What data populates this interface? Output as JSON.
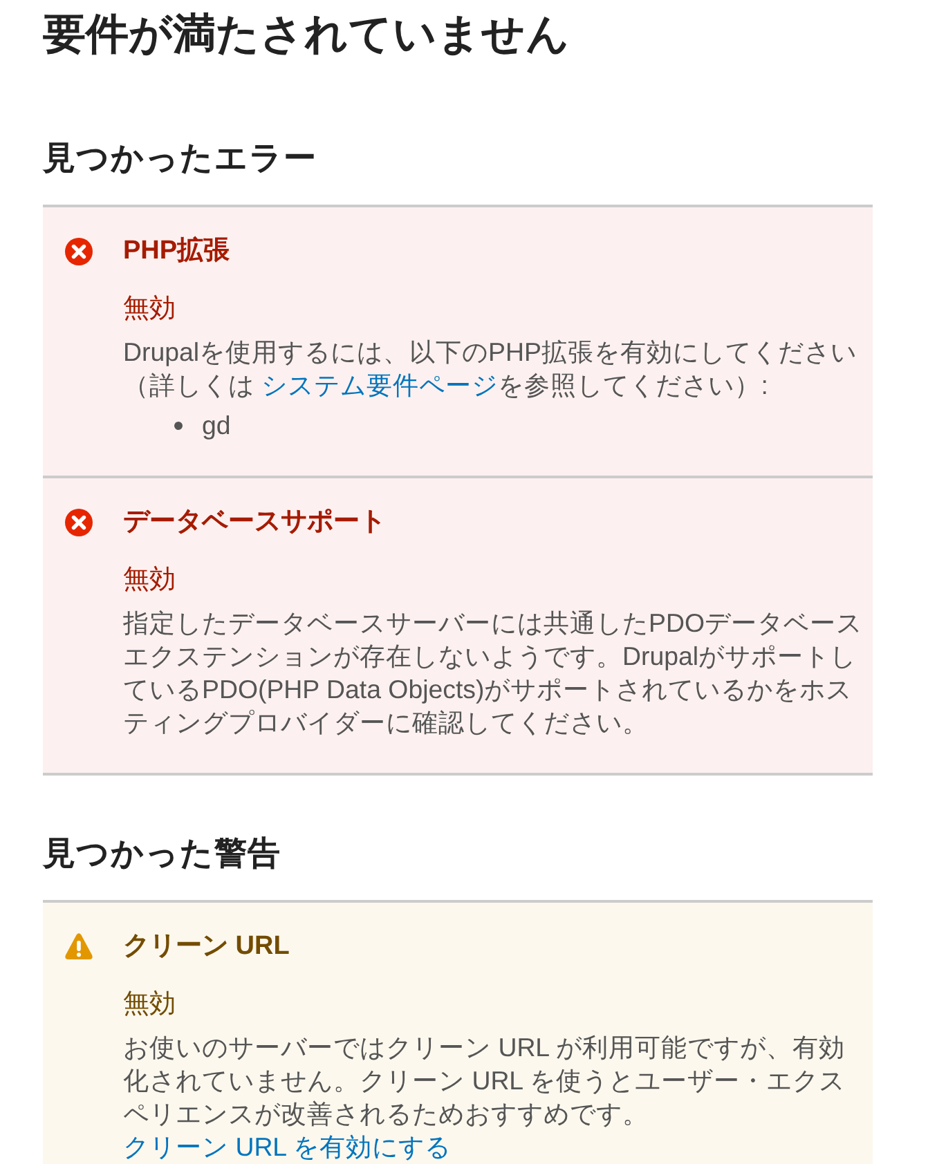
{
  "page_title": "要件が満たされていません",
  "sections": [
    {
      "heading": "見つかったエラー",
      "kind": "error",
      "items": [
        {
          "title": "PHP拡張",
          "status": "無効",
          "description": [
            {
              "kind": "text",
              "text": "Drupalを使用するには、以下のPHP拡張を有効にしてください（詳しくは "
            },
            {
              "kind": "link",
              "text": "システム要件ページ"
            },
            {
              "kind": "text",
              "text": "を参照してください）:"
            }
          ],
          "list": [
            "gd"
          ]
        },
        {
          "title": "データベースサポート",
          "status": "無効",
          "description": [
            {
              "kind": "text",
              "text": "指定したデータベースサーバーには共通したPDOデータベースエクステンションが存在しないようです。DrupalがサポートしているPDO(PHP Data Objects)がサポートされているかをホスティングプロバイダーに確認してください。"
            }
          ]
        }
      ]
    },
    {
      "heading": "見つかった警告",
      "kind": "warning",
      "items": [
        {
          "title": "クリーン URL",
          "status": "無効",
          "description": [
            {
              "kind": "text",
              "text": "お使いのサーバーではクリーン URL が利用可能ですが、有効化されていません。クリーン URL を使うとユーザー・エクスペリエンスが改善されるためおすすめです。"
            },
            {
              "kind": "link",
              "text": "クリーン URL を有効にする"
            }
          ]
        }
      ]
    }
  ]
}
